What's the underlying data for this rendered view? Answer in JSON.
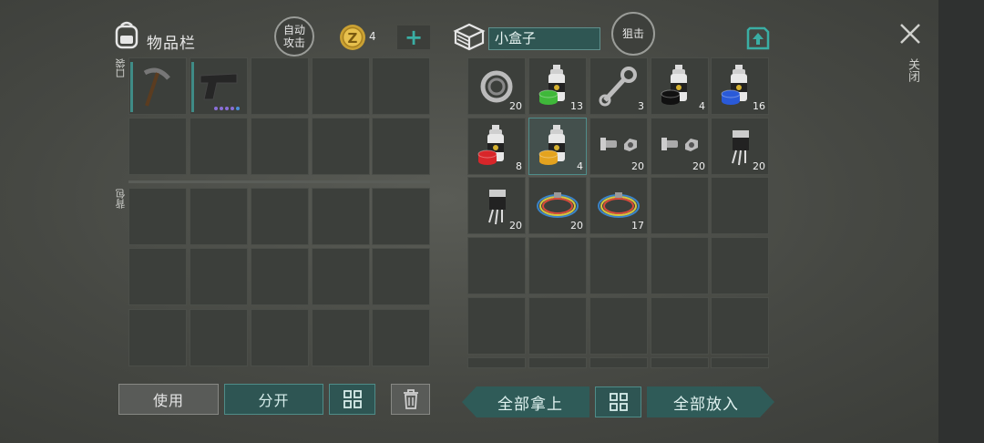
{
  "inventory": {
    "title": "物品栏",
    "auto_attack": "自动\n攻击",
    "pocket_label": "口袋",
    "backpack_label": "背包",
    "coin_count": "4",
    "add_symbol": "+",
    "pocket_slots": [
      {
        "item": "pickaxe",
        "qty": ""
      },
      {
        "item": "pistol",
        "qty": ""
      }
    ]
  },
  "container": {
    "name": "小盒子",
    "snipe": "狙击",
    "items": [
      {
        "item": "bearing",
        "qty": "20"
      },
      {
        "item": "spray-can-green",
        "qty": "13"
      },
      {
        "item": "wrench",
        "qty": "3"
      },
      {
        "item": "spray-can-black",
        "qty": "4"
      },
      {
        "item": "spray-can-blue",
        "qty": "16"
      },
      {
        "item": "spray-can-red",
        "qty": "8"
      },
      {
        "item": "spray-can-yellow",
        "qty": "4"
      },
      {
        "item": "bolts",
        "qty": "20"
      },
      {
        "item": "bolts",
        "qty": "20"
      },
      {
        "item": "transistor",
        "qty": "20"
      },
      {
        "item": "transistor",
        "qty": "20"
      },
      {
        "item": "wires",
        "qty": "20"
      },
      {
        "item": "wires",
        "qty": "17"
      }
    ]
  },
  "close_label": "关闭",
  "buttons": {
    "use": "使用",
    "split": "分开",
    "take_all": "全部拿上",
    "put_all": "全部放入"
  },
  "colors": {
    "accent_teal": "#2f5b58",
    "slot_bg": "#3c3f3b",
    "green_paint": "#3fb83a",
    "black_paint": "#111111",
    "blue_paint": "#2a5ad8",
    "red_paint": "#d8262a",
    "yellow_paint": "#e4a31f"
  }
}
